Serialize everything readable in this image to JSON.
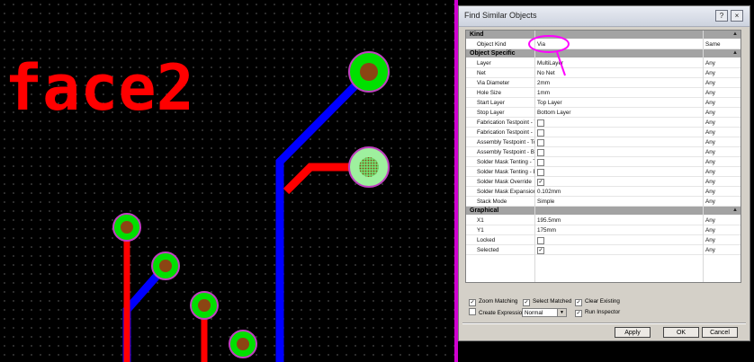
{
  "canvas": {
    "label": "face2",
    "colors": {
      "top_layer": "#ff0000",
      "bottom_layer": "#0000ff",
      "pad": "#00e000",
      "pad_ring": "#c040c0",
      "hole": "#8b4513",
      "selection": "#ff00ff"
    }
  },
  "dialog": {
    "title": "Find Similar Objects",
    "help_label": "?",
    "close_label": "×",
    "sections": {
      "kind": {
        "label": "Kind"
      },
      "object_specific": {
        "label": "Object Specific"
      },
      "graphical": {
        "label": "Graphical"
      }
    },
    "kind_rows": [
      {
        "name": "Object Kind",
        "value": "Via",
        "option": "Same"
      }
    ],
    "object_rows": [
      {
        "name": "Layer",
        "value": "MultiLayer",
        "option": "Any"
      },
      {
        "name": "Net",
        "value": "No Net",
        "option": "Any"
      },
      {
        "name": "Via Diameter",
        "value": "2mm",
        "option": "Any"
      },
      {
        "name": "Hole Size",
        "value": "1mm",
        "option": "Any"
      },
      {
        "name": "Start Layer",
        "value": "Top Layer",
        "option": "Any"
      },
      {
        "name": "Stop Layer",
        "value": "Bottom Layer",
        "option": "Any"
      },
      {
        "name": "Fabrication Testpoint - T",
        "checked": false,
        "option": "Any"
      },
      {
        "name": "Fabrication Testpoint - B",
        "checked": false,
        "option": "Any"
      },
      {
        "name": "Assembly Testpoint - Top",
        "checked": false,
        "option": "Any"
      },
      {
        "name": "Assembly Testpoint - Bot",
        "checked": false,
        "option": "Any"
      },
      {
        "name": "Solder Mask Tenting - To",
        "checked": false,
        "option": "Any"
      },
      {
        "name": "Solder Mask Tenting - Bo",
        "checked": false,
        "option": "Any"
      },
      {
        "name": "Solder Mask Override",
        "checked": true,
        "option": "Any"
      },
      {
        "name": "Solder Mask Expansion",
        "value": "0.102mm",
        "option": "Any"
      },
      {
        "name": "Stack Mode",
        "value": "Simple",
        "option": "Any"
      }
    ],
    "graphical_rows": [
      {
        "name": "X1",
        "value": "195.5mm",
        "option": "Any"
      },
      {
        "name": "Y1",
        "value": "175mm",
        "option": "Any"
      },
      {
        "name": "Locked",
        "checked": false,
        "option": "Any"
      },
      {
        "name": "Selected",
        "checked": true,
        "option": "Any"
      }
    ],
    "options": {
      "zoom_matching": {
        "label": "Zoom Matching",
        "checked": true
      },
      "select_matched": {
        "label": "Select Matched",
        "checked": true
      },
      "clear_existing": {
        "label": "Clear Existing",
        "checked": true
      },
      "create_expression": {
        "label": "Create Expression",
        "checked": false
      },
      "expression_mode": "Normal",
      "run_inspector": {
        "label": "Run Inspector",
        "checked": true
      }
    },
    "buttons": {
      "apply": "Apply",
      "ok": "OK",
      "cancel": "Cancel"
    }
  }
}
